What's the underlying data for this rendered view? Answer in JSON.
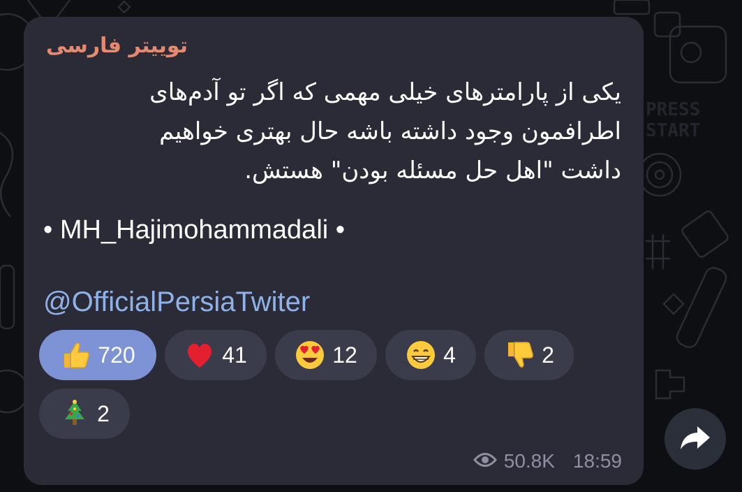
{
  "message": {
    "sender_name": "توییتر فارسی",
    "text_lines": [
      "یکی از پارامترهای خیلی مهمی که اگر تو آدم‌های",
      "اطرافمون وجود داشته باشه حال بهتری خواهیم",
      "داشت \"اهل حل مسئله بودن\" هستش."
    ],
    "author_line": "• MH_Hajimohammadali •",
    "channel_handle": "@OfficialPersiaTwiter",
    "views": "50.8K",
    "time": "18:59"
  },
  "reactions": [
    {
      "emoji": "thumbs-up-icon",
      "count": "720",
      "active": true
    },
    {
      "emoji": "heart-icon",
      "count": "41",
      "active": false
    },
    {
      "emoji": "heart-eyes-icon",
      "count": "12",
      "active": false
    },
    {
      "emoji": "grin-icon",
      "count": "4",
      "active": false
    },
    {
      "emoji": "thumbs-down-icon",
      "count": "2",
      "active": false
    },
    {
      "emoji": "christmas-tree-icon",
      "count": "2",
      "active": false
    }
  ],
  "colors": {
    "background": "#0d0f12",
    "bubble": "#2b2b38",
    "sender": "#e38a6f",
    "link": "#8fb3e8",
    "reaction_active": "#7e92d6",
    "reaction_inactive": "#3b3c4b"
  }
}
